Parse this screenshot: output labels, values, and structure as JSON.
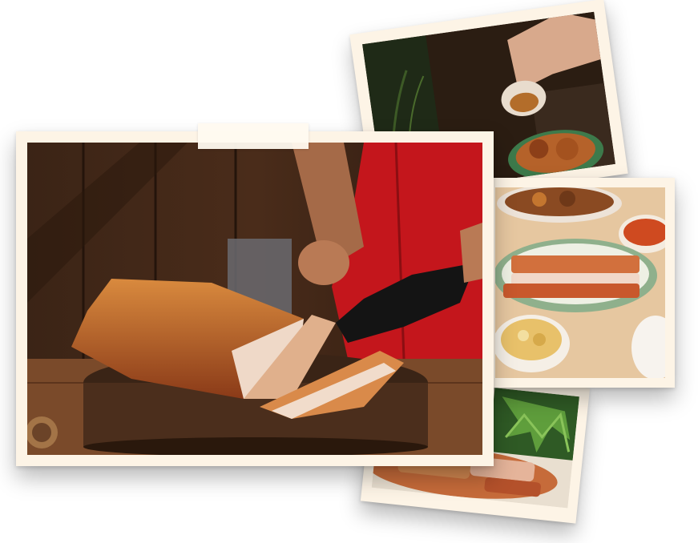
{
  "collage": {
    "photos": [
      {
        "id": "main",
        "subject": "roast-pork-chopping"
      },
      {
        "id": "top",
        "subject": "sauce-pouring"
      },
      {
        "id": "right",
        "subject": "table-spread"
      },
      {
        "id": "bottom",
        "subject": "herbs-and-roast"
      }
    ],
    "frame_color": "#fdf4e6",
    "tape_color": "#fffaf0"
  }
}
